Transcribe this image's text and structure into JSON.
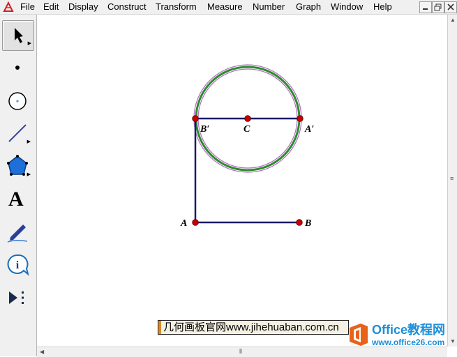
{
  "menubar": {
    "items": [
      "File",
      "Edit",
      "Display",
      "Construct",
      "Transform",
      "Measure",
      "Number",
      "Graph",
      "Window",
      "Help"
    ]
  },
  "window_controls": {
    "minimize_icon": "minimize-icon",
    "restore_icon": "restore-icon",
    "close_icon": "close-icon"
  },
  "toolbox": {
    "tools": [
      "arrow-select-tool",
      "point-tool",
      "compass-tool",
      "straightedge-tool",
      "polygon-tool",
      "text-tool",
      "marker-tool",
      "information-tool",
      "custom-tool"
    ],
    "text_tool_glyph": "A"
  },
  "sketch": {
    "points": {
      "A": "A",
      "B": "B",
      "C": "C",
      "A_prime": "A′",
      "B_prime": "B′"
    },
    "colors": {
      "segment": "#1a1a66",
      "point": "#cc0000",
      "circle_outer": "#b06cc0",
      "circle_mid": "#2e8b2e"
    }
  },
  "watermark": {
    "text": "几何画板官网www.jihehuaban.com.cn"
  },
  "logo": {
    "brand": "Office教程网",
    "url": "www.office26.com"
  }
}
